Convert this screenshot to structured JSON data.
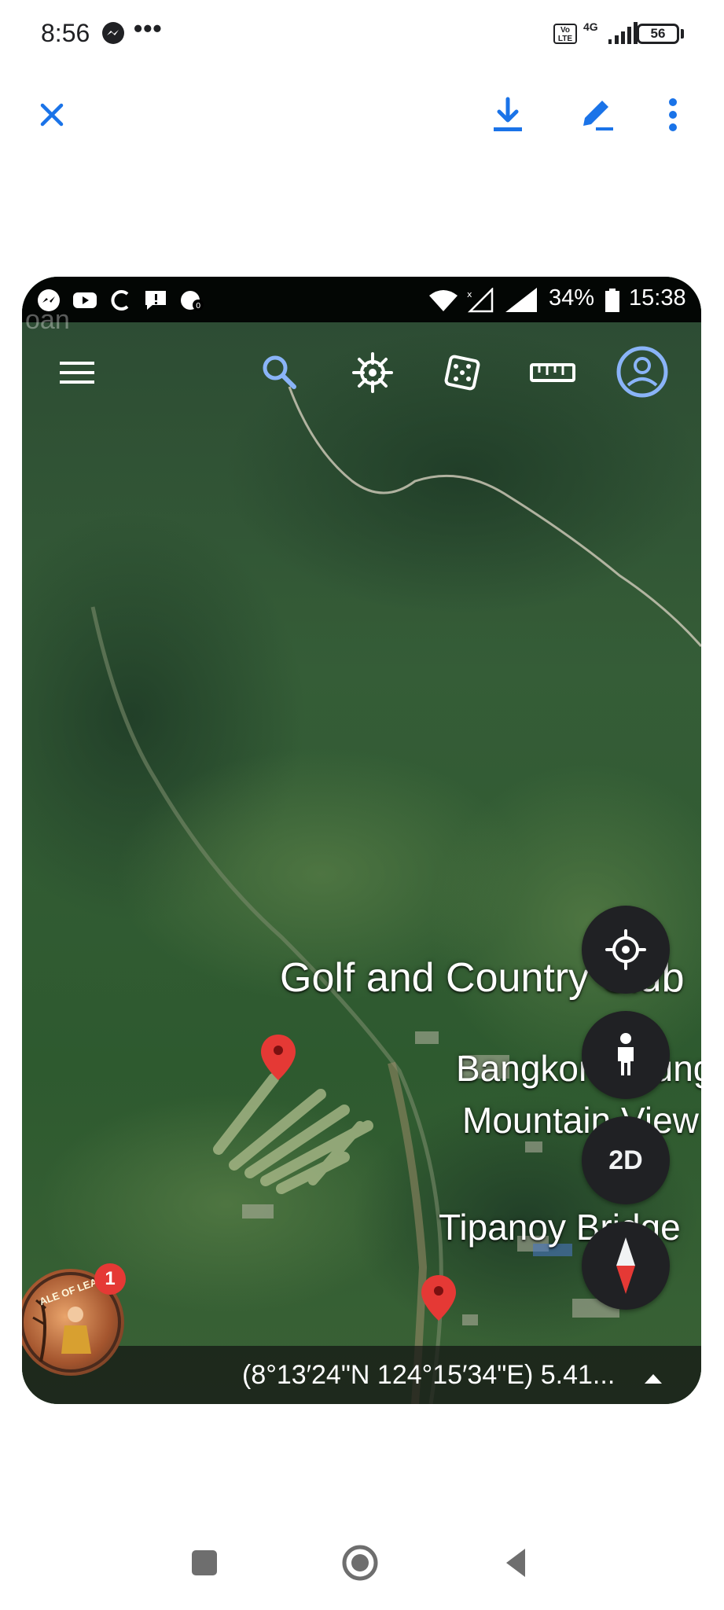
{
  "outer_status": {
    "time": "8:56",
    "dots": "•••",
    "volte": "Vo LTE",
    "network": "4G",
    "battery": "56"
  },
  "inner_status": {
    "battery_pct": "34%",
    "time": "15:38"
  },
  "map": {
    "ghost_label": "oan",
    "labels": {
      "golf": "Golf and Country Club",
      "bangko": "Bangkong Bungkol",
      "mountain": "Mountain View",
      "tipanoy": "Tipanoy Bridge"
    },
    "view_toggle": "2D",
    "coordinates": "(8°13′24\"N 124°15′34\"E) 5.41...",
    "notification_count": "1",
    "chathead_text": "ALE OF LEAH"
  },
  "colors": {
    "accent_blue": "#1a73e8",
    "fab_bg": "#202124",
    "pin_red": "#e53935",
    "map_green": "#2f5a32"
  },
  "icons": [
    "close-icon",
    "download-icon",
    "edit-icon",
    "more-icon",
    "menu-icon",
    "search-icon",
    "voyager-icon",
    "dice-icon",
    "ruler-icon",
    "account-icon",
    "my-location-icon",
    "pegman-icon",
    "compass-icon",
    "map-pin-icon",
    "square-nav-icon",
    "home-nav-icon",
    "back-nav-icon"
  ]
}
